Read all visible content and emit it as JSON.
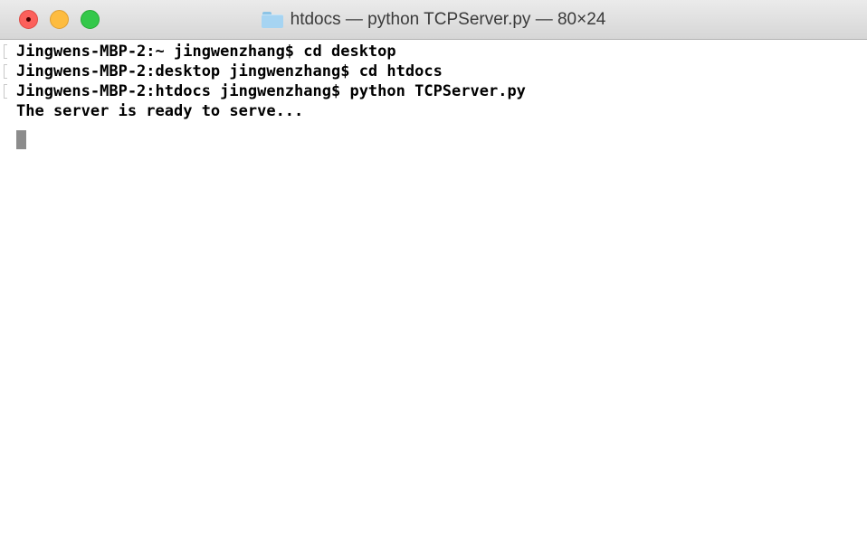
{
  "window": {
    "title": "htdocs — python TCPServer.py — 80×24"
  },
  "terminal": {
    "lines": [
      "Jingwens-MBP-2:~ jingwenzhang$ cd desktop",
      "Jingwens-MBP-2:desktop jingwenzhang$ cd htdocs",
      "Jingwens-MBP-2:htdocs jingwenzhang$ python TCPServer.py",
      "The server is ready to serve..."
    ]
  },
  "colors": {
    "close": "#fc605b",
    "minimize": "#fdbc40",
    "zoom": "#34c84a",
    "folder": "#a6d4f2",
    "cursor": "#8c8c8c"
  },
  "icons": {
    "title": "folder-icon"
  }
}
